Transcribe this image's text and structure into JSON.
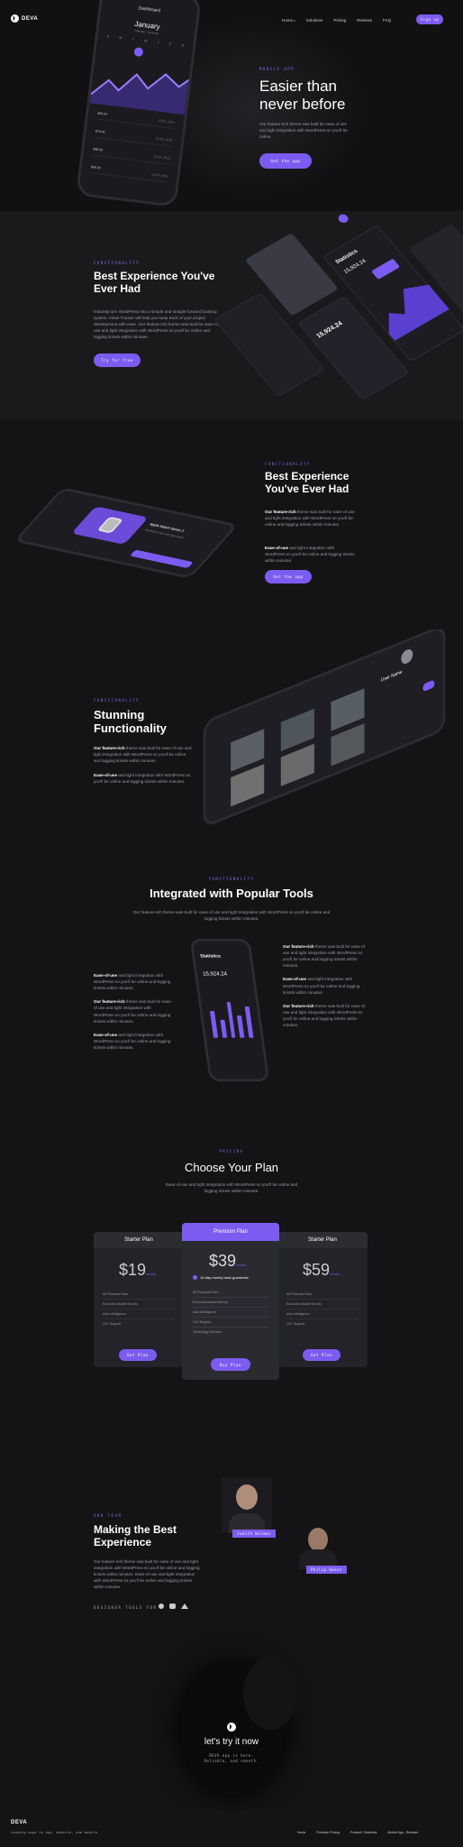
{
  "header": {
    "brand": "DEVA",
    "nav": [
      "Home",
      "Solutions",
      "Pricing",
      "Reviews",
      "FAQ"
    ],
    "nav_indicator": "▾",
    "cta": "Sign up"
  },
  "hero": {
    "tag": "MOBILE APP",
    "title": "Easier than never before",
    "text": "Our feature-rich theme was built for ease of use and tight integration with WordPress so you'll be online.",
    "button": "Get the app",
    "phone": {
      "title": "Dashboard",
      "month": "January",
      "sub": "Calendar · Schedule",
      "days": [
        "S",
        "M",
        "T",
        "W",
        "T",
        "F",
        "S"
      ],
      "rows": [
        {
          "v": "$98.00",
          "d": "12:00, 2019"
        },
        {
          "v": "$78.00",
          "d": "12:00, 2019"
        },
        {
          "v": "$98.00",
          "d": "12:00, 2019"
        },
        {
          "v": "$98.00",
          "d": "12:00, 2019"
        }
      ]
    }
  },
  "f1": {
    "tag": "FUNCTIONALITY",
    "title": "Best Experience You've Ever Had",
    "text": "Instantly turn WordPress into a simple and straight forward booking system. Asset Tracker will help you keep track of your project development with ease. Our feature-rich theme was built for ease of use and tight integration with WordPress so you'll be online and logging tickets within minutes.",
    "button": "Try for free",
    "stats": "Statistics",
    "amount": "15,924.24",
    "amount2": "15,924.24",
    "n24": "24"
  },
  "f2": {
    "tag": "FUNCTIONALITY",
    "title": "Best Experience You've Ever Had",
    "p1_bold": "Our feature-rich",
    "p1": " theme was built for ease of use and tight integration with WordPress so you'll be online and logging tickets within minutes.",
    "p2_bold": "Ease-of-use",
    "p2": " and tight integration with WordPress so you'll be online and logging tickets within minutes.",
    "button": "Get the app",
    "phone_title": "Apple Watch Series 3",
    "phone_sub": "Aluminium Case with Sport Band"
  },
  "f3": {
    "tag": "FUNCTIONALITY",
    "title": "Stunning Functionality",
    "p1_bold": "Our feature-rich",
    "p1": " theme was built for ease of use and tight integration with WordPress so you'll be online and logging tickets within minutes.",
    "p2_bold": "Ease-of-use",
    "p2": " and tight integration with WordPress so you'll be online and logging tickets within minutes.",
    "phone_user": "User Name"
  },
  "integrations": {
    "tag": "FUNCTIONALITY",
    "title": "Integrated with Popular Tools",
    "text": "Our feature-rich theme was built for ease of use and tight integration with WordPress so you'll be online and logging tickets within minutes.",
    "left": [
      {
        "b": "Ease-of-use",
        "t": " and tight integration with WordPress so you'll be online and logging tickets within minutes."
      },
      {
        "b": "Our feature-rich",
        "t": " theme was built for ease of use and tight integration with WordPress so you'll be online and logging tickets within minutes."
      },
      {
        "b": "Ease-of-use",
        "t": " and tight integration with WordPress so you'll be online and logging tickets within minutes."
      }
    ],
    "right": [
      {
        "b": "Our feature-rich",
        "t": " theme was built for ease of use and tight integration with WordPress so you'll be online and logging tickets within minutes."
      },
      {
        "b": "Ease-of-use",
        "t": " and tight integration with WordPress so you'll be online and logging tickets within minutes."
      },
      {
        "b": "Our feature-rich",
        "t": " theme was built for ease of use and tight integration with WordPress so you'll be online and logging tickets within minutes."
      }
    ],
    "phone_title": "Statistics",
    "phone_amount": "15,924.24"
  },
  "pricing": {
    "tag": "PRICING",
    "title": "Choose Your Plan",
    "text": "Ease-of-use and tight integration with WordPress so you'll be online and logging tickets within minutes.",
    "plans": [
      {
        "name": "Starter Plan",
        "price": "$19",
        "per": "/month",
        "features": [
          "All Financial Tools",
          "Economic Market Survey",
          "Auto Intelligence",
          "24/7 Support"
        ],
        "button": "Get Plan"
      },
      {
        "name": "Premium Plan",
        "price": "$39",
        "per": "/month",
        "guarantee": "14-day money back guarantee",
        "features": [
          "All Financial Tools",
          "Economic Market Survey",
          "Auto Intelligence",
          "24/7 Support",
          "Technology Services"
        ],
        "button": "Buy Plan"
      },
      {
        "name": "Starter Plan",
        "price": "$59",
        "per": "/month",
        "features": [
          "All Financial Tools",
          "Economic Market Survey",
          "Auto Intelligence",
          "24/7 Support"
        ],
        "button": "Get Plan"
      }
    ]
  },
  "team": {
    "tag": "OUR TEAM",
    "title": "Making the Best Experience",
    "text": "Our feature-rich theme was built for ease of use and tight integration with WordPress so you'll be online and logging tickets within minutes. Ease-of-use and tight integration with WordPress so you'll be online and logging tickets within minutes.",
    "designer": "DESIGNER TOOLS FOR",
    "m1": "Judith Holmes",
    "m2": "Philip Owens"
  },
  "cta": {
    "title": "let's try it now",
    "text": "DEVA app is here. Reliable, and smooth."
  },
  "footer": {
    "brand": "DEVA",
    "text": "Landing page to app, website, and mobile",
    "links": [
      "Home",
      "Premium Pricing",
      "Product / Solutions",
      "Mobile App - Reviews"
    ]
  }
}
